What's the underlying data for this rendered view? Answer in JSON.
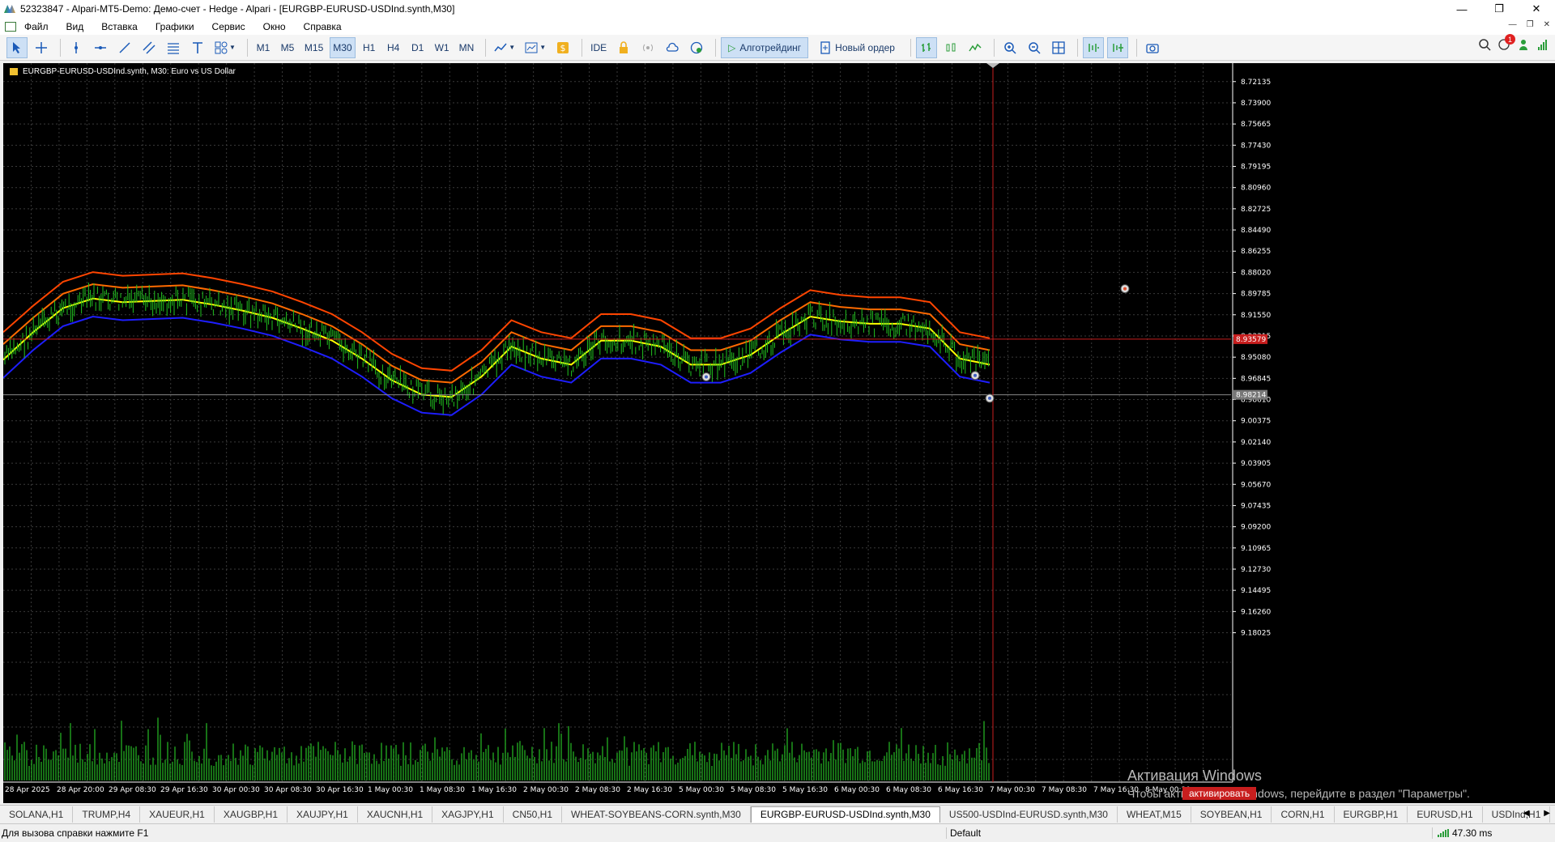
{
  "window": {
    "title": "52323847 - Alpari-MT5-Demo: Демо-счет - Hedge - Alpari - [EURGBP-EURUSD-USDInd.synth,M30]",
    "controls": [
      "—",
      "❐",
      "✕"
    ]
  },
  "menu": {
    "items": [
      "Файл",
      "Вид",
      "Вставка",
      "Графики",
      "Сервис",
      "Окно",
      "Справка"
    ]
  },
  "toolbar": {
    "timeframes": [
      "M1",
      "M5",
      "M15",
      "M30",
      "H1",
      "H4",
      "D1",
      "W1",
      "MN"
    ],
    "active_timeframe": "M30",
    "ide_label": "IDE",
    "algo_label": "Алготрейдинг",
    "new_order_label": "Новый ордер",
    "notif_count": "1"
  },
  "chart": {
    "title": "EURGBP-EURUSD-USDInd.synth, M30:  Euro vs US Dollar",
    "background": "#000000",
    "grid_color": "#3a3a3a",
    "current_price_label": "8.93579",
    "crosshair_price_label": "8.98214",
    "watermark_line1": "Активация Windows",
    "watermark_line2": "Чтобы активировать Windows, перейдите в раздел \"Параметры\".",
    "trade_label": "активировать"
  },
  "chart_data": {
    "type": "line",
    "inverted_y": true,
    "ylim": [
      8.706,
      9.19
    ],
    "y_ticks": [
      "8.72135",
      "8.73900",
      "8.75665",
      "8.77430",
      "8.79195",
      "8.80960",
      "8.82725",
      "8.84490",
      "8.86255",
      "8.88020",
      "8.89785",
      "8.91550",
      "8.93315",
      "8.95080",
      "8.96845",
      "8.98610",
      "9.00375",
      "9.02140",
      "9.03905",
      "9.05670",
      "9.07435",
      "9.09200",
      "9.10965",
      "9.12730",
      "9.14495",
      "9.16260",
      "9.18025"
    ],
    "x_ticks": [
      "28 Apr 2025",
      "28 Apr 20:00",
      "29 Apr 08:30",
      "29 Apr 16:30",
      "30 Apr 00:30",
      "30 Apr 08:30",
      "30 Apr 16:30",
      "1 May 00:30",
      "1 May 08:30",
      "1 May 16:30",
      "2 May 00:30",
      "2 May 08:30",
      "2 May 16:30",
      "5 May 00:30",
      "5 May 08:30",
      "5 May 16:30",
      "6 May 00:30",
      "6 May 08:30",
      "6 May 16:30",
      "7 May 00:30",
      "7 May 08:30",
      "7 May 16:30",
      "8 May 00:30"
    ],
    "series": [
      {
        "color": "#ff4500",
        "values": [
          8.93,
          8.908,
          8.888,
          8.88,
          8.883,
          8.882,
          8.881,
          8.885,
          8.89,
          8.896,
          8.905,
          8.915,
          8.93,
          8.948,
          8.96,
          8.962,
          8.945,
          8.92,
          8.93,
          8.935,
          8.915,
          8.915,
          8.92,
          8.935,
          8.935,
          8.927,
          8.91,
          8.895,
          8.899,
          8.901,
          8.901,
          8.905,
          8.93,
          8.935
        ]
      },
      {
        "color": "#ff6a00",
        "values": [
          8.94,
          8.918,
          8.898,
          8.89,
          8.893,
          8.892,
          8.891,
          8.895,
          8.9,
          8.906,
          8.915,
          8.925,
          8.94,
          8.958,
          8.97,
          8.972,
          8.955,
          8.93,
          8.94,
          8.945,
          8.925,
          8.925,
          8.93,
          8.945,
          8.945,
          8.937,
          8.92,
          8.905,
          8.909,
          8.911,
          8.911,
          8.915,
          8.94,
          8.945
        ]
      },
      {
        "color": "#ffff00",
        "values": [
          8.953,
          8.93,
          8.91,
          8.902,
          8.905,
          8.904,
          8.903,
          8.907,
          8.912,
          8.918,
          8.927,
          8.937,
          8.952,
          8.97,
          8.982,
          8.984,
          8.967,
          8.942,
          8.952,
          8.957,
          8.937,
          8.937,
          8.942,
          8.957,
          8.957,
          8.949,
          8.932,
          8.917,
          8.921,
          8.923,
          8.923,
          8.927,
          8.952,
          8.957
        ]
      },
      {
        "color": "#1e1eff",
        "values": [
          8.968,
          8.945,
          8.925,
          8.917,
          8.92,
          8.919,
          8.918,
          8.922,
          8.927,
          8.933,
          8.942,
          8.952,
          8.967,
          8.985,
          8.997,
          8.999,
          8.982,
          8.957,
          8.967,
          8.972,
          8.952,
          8.952,
          8.957,
          8.972,
          8.972,
          8.964,
          8.947,
          8.932,
          8.936,
          8.938,
          8.938,
          8.942,
          8.967,
          8.972
        ]
      }
    ]
  },
  "tabs": {
    "items": [
      "SOLANA,H1",
      "TRUMP,H4",
      "XAUEUR,H1",
      "XAUGBP,H1",
      "XAUJPY,H1",
      "XAUCNH,H1",
      "XAGJPY,H1",
      "CN50,H1",
      "WHEAT-SOYBEANS-CORN.synth,M30",
      "EURGBP-EURUSD-USDInd.synth,M30",
      "US500-USDInd-EURUSD.synth,M30",
      "WHEAT,M15",
      "SOYBEAN,H1",
      "CORN,H1",
      "EURGBP,H1",
      "EURUSD,H1",
      "USDInd,H1"
    ],
    "active_index": 9
  },
  "status": {
    "help": "Для вызова справки нажмите F1",
    "profile": "Default",
    "ping": "47.30 ms"
  }
}
